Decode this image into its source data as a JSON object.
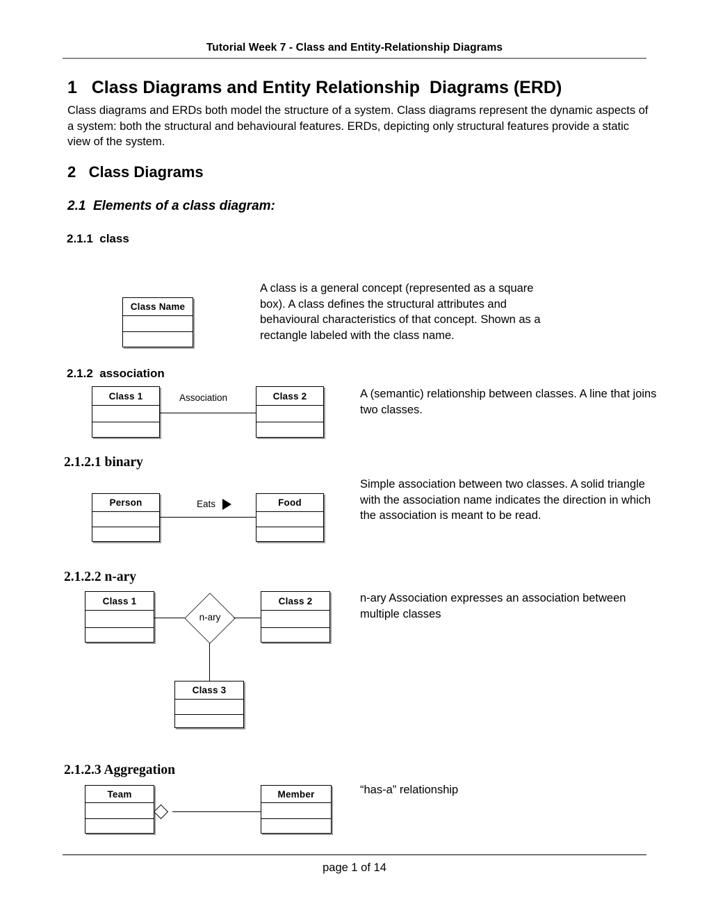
{
  "header": {
    "title": "Tutorial Week 7 - Class and Entity-Relationship Diagrams"
  },
  "sections": {
    "s1": {
      "number": "1",
      "title": "Class Diagrams and Entity Relationship  Diagrams (ERD)",
      "heading": "1   Class Diagrams and Entity Relationship  Diagrams (ERD)",
      "body": "Class diagrams and ERDs both model the structure of a system.  Class diagrams represent the dynamic aspects of a system: both the structural and behavioural features. ERDs, depicting only structural features  provide a static view of the system."
    },
    "s2": {
      "heading": "2   Class Diagrams"
    },
    "s2_1": {
      "heading": "2.1  Elements of a class diagram:"
    },
    "s2_1_1": {
      "heading": "2.1.1  class",
      "description": "A class is a general concept (represented as a square box). A class defines the structural attributes and behavioural characteristics of that concept.  Shown as a  rectangle labeled with the class name."
    },
    "s2_1_2": {
      "heading": "2.1.2  association",
      "description": "A (semantic) relationship between classes. A line that joins two classes."
    },
    "s2_1_2_1": {
      "heading": "2.1.2.1 binary",
      "description": "Simple association between two classes.  A solid triangle with the  association name indicates the direction in which the association is meant to be read."
    },
    "s2_1_2_2": {
      "heading": "2.1.2.2 n-ary",
      "description": "n-ary Association  expresses an association between multiple classes"
    },
    "s2_1_2_3": {
      "heading": "2.1.2.3 Aggregation",
      "description": "“has-a” relationship"
    }
  },
  "diagrams": {
    "class_box": {
      "name": "Class Name"
    },
    "association": {
      "left_class": "Class 1",
      "right_class": "Class 2",
      "label": "Association"
    },
    "binary": {
      "left_class": "Person",
      "right_class": "Food",
      "label": "Eats",
      "arrow": "solid-triangle-right"
    },
    "nary": {
      "left_class": "Class 1",
      "right_class": "Class 2",
      "bottom_class": "Class 3",
      "diamond_label": "n-ary"
    },
    "aggregation": {
      "left_class": "Team",
      "right_class": "Member",
      "diamond": "hollow-diamond"
    }
  },
  "footer": {
    "page_label": "page 1 of 14"
  }
}
